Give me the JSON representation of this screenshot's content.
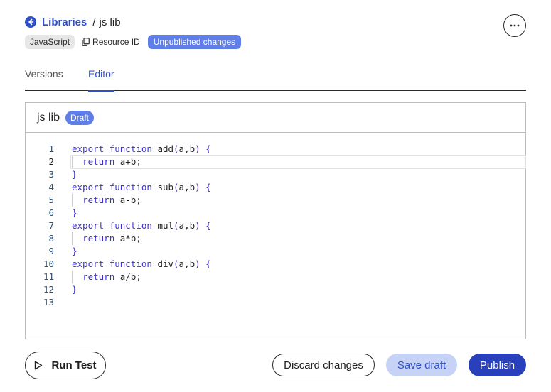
{
  "breadcrumb": {
    "parent": "Libraries",
    "separator": "/",
    "current": "js lib"
  },
  "chips": {
    "language": "JavaScript",
    "resource_id": "Resource ID",
    "status": "Unpublished changes"
  },
  "tabs": [
    {
      "label": "Versions",
      "active": false
    },
    {
      "label": "Editor",
      "active": true
    }
  ],
  "editor": {
    "title": "js lib",
    "badge": "Draft",
    "active_line": 2,
    "lines": [
      {
        "n": "1",
        "code": "export function add(a,b) {"
      },
      {
        "n": "2",
        "code": "  return a+b;"
      },
      {
        "n": "3",
        "code": "}"
      },
      {
        "n": "4",
        "code": "export function sub(a,b) {"
      },
      {
        "n": "5",
        "code": "  return a-b;"
      },
      {
        "n": "6",
        "code": "}"
      },
      {
        "n": "7",
        "code": "export function mul(a,b) {"
      },
      {
        "n": "8",
        "code": "  return a*b;"
      },
      {
        "n": "9",
        "code": "}"
      },
      {
        "n": "10",
        "code": "export function div(a,b) {"
      },
      {
        "n": "11",
        "code": "  return a/b;"
      },
      {
        "n": "12",
        "code": "}"
      },
      {
        "n": "13",
        "code": ""
      }
    ]
  },
  "footer": {
    "run_test": "Run Test",
    "discard": "Discard changes",
    "save_draft": "Save draft",
    "publish": "Publish"
  },
  "colors": {
    "accent": "#2f4fc8",
    "badge": "#5f7ee8",
    "publish": "#2840bb",
    "save_draft_bg": "#c6d3f6"
  },
  "icons": {
    "back": "arrow-left-circle-icon",
    "more": "more-horizontal-icon",
    "copy": "copy-icon",
    "run": "play-icon"
  }
}
